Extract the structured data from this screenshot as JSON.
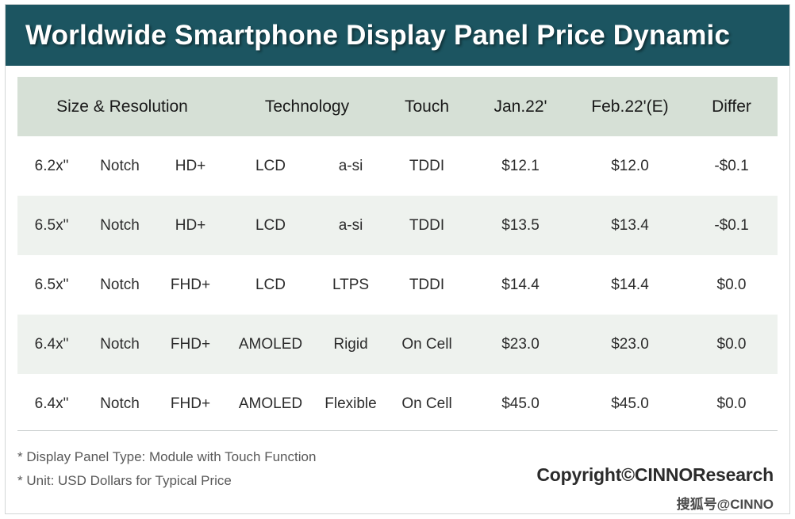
{
  "title": "Worldwide Smartphone Display Panel Price Dynamic",
  "table": {
    "header_groups": [
      {
        "label": "Size & Resolution",
        "span": 3
      },
      {
        "label": "Technology",
        "span": 2
      },
      {
        "label": "Touch",
        "span": 1
      },
      {
        "label": "Jan.22'",
        "span": 1
      },
      {
        "label": "Feb.22'(E)",
        "span": 1
      },
      {
        "label": "Differ",
        "span": 1
      }
    ],
    "rows": [
      {
        "size": "6.2x\"",
        "notch": "Notch",
        "resolution": "HD+",
        "panel": "LCD",
        "backplane": "a-si",
        "touch": "TDDI",
        "jan": "$12.1",
        "feb": "$12.0",
        "differ": "-$0.1"
      },
      {
        "size": "6.5x\"",
        "notch": "Notch",
        "resolution": "HD+",
        "panel": "LCD",
        "backplane": "a-si",
        "touch": "TDDI",
        "jan": "$13.5",
        "feb": "$13.4",
        "differ": "-$0.1"
      },
      {
        "size": "6.5x\"",
        "notch": "Notch",
        "resolution": "FHD+",
        "panel": "LCD",
        "backplane": "LTPS",
        "touch": "TDDI",
        "jan": "$14.4",
        "feb": "$14.4",
        "differ": "$0.0"
      },
      {
        "size": "6.4x\"",
        "notch": "Notch",
        "resolution": "FHD+",
        "panel": "AMOLED",
        "backplane": "Rigid",
        "touch": "On Cell",
        "jan": "$23.0",
        "feb": "$23.0",
        "differ": "$0.0"
      },
      {
        "size": "6.4x\"",
        "notch": "Notch",
        "resolution": "FHD+",
        "panel": "AMOLED",
        "backplane": "Flexible",
        "touch": "On Cell",
        "jan": "$45.0",
        "feb": "$45.0",
        "differ": "$0.0"
      }
    ]
  },
  "footer": {
    "note_1": "* Display Panel Type:  Module with Touch Function",
    "note_2": "* Unit:  USD Dollars for Typical Price",
    "copyright": "Copyright©CINNOResearch",
    "watermark": "搜狐号@CINNO"
  },
  "colors": {
    "title_bar": "#1c5561",
    "header_band": "#d6e0d6",
    "row_alt": "#eef2ee",
    "divider": "#c9cdcd"
  }
}
